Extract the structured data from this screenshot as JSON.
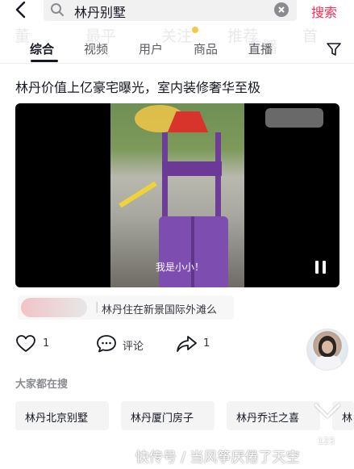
{
  "search": {
    "query": "林丹别墅",
    "submit_label": "搜索"
  },
  "ghost_nav": [
    "董",
    "最平",
    "关注",
    "推荐",
    "直播",
    "首"
  ],
  "tabs": [
    {
      "label": "综合",
      "active": true
    },
    {
      "label": "视频",
      "active": false
    },
    {
      "label": "用户",
      "active": false
    },
    {
      "label": "商品",
      "active": false
    },
    {
      "label": "直播",
      "active": false
    }
  ],
  "result": {
    "title": "林丹价值上亿豪宅曝光，室内装修奢华至极",
    "video_caption": "我是小小！",
    "source_separator": "|",
    "source_text": "林丹住在新景国际外滩么"
  },
  "actions": {
    "like_count": "1",
    "comment_label": "评论",
    "share_count": "1"
  },
  "people_searching": {
    "title": "大家都在搜",
    "chips": [
      "林丹北京别墅",
      "林丹厦门房子",
      "林丹乔迁之喜",
      "林"
    ]
  },
  "watermark": {
    "text": "快传号 / 当风筝厌倦了天空",
    "number": "123"
  },
  "colors": {
    "accent": "#fe2c55",
    "text_primary": "#161823",
    "text_secondary": "#8a8b91"
  }
}
